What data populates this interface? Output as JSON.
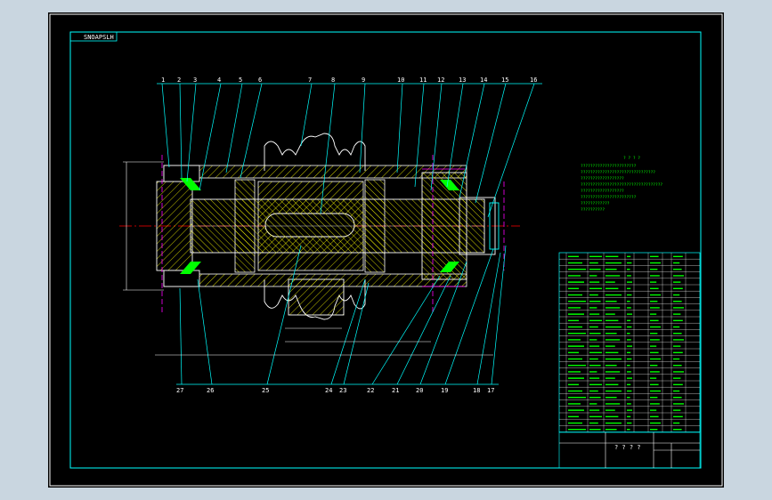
{
  "drawing": {
    "tag": "SNOAPSLH",
    "title_block_text": "? ? ? ?",
    "tech_notes_title": "? ? ? ?",
    "tech_notes": [
      "???????????????????????",
      "???????????????????????????????",
      "??????????????????",
      "??????????????????????????????????",
      "??????????????????",
      "???????????????????????",
      "????????????",
      "??????????"
    ],
    "part_numbers_top": [
      "1",
      "2",
      "3",
      "4",
      "5",
      "6",
      "7",
      "8",
      "9",
      "10",
      "11",
      "12",
      "13",
      "14",
      "15",
      "16"
    ],
    "part_numbers_bottom": [
      "27",
      "26",
      "25",
      "24",
      "23",
      "22",
      "21",
      "20",
      "19",
      "18",
      "17"
    ]
  },
  "colors": {
    "background": "#000000",
    "frame": "#00ffff",
    "centerline": "#ff0000",
    "hatch": "#ffff00",
    "outline": "#ffffff",
    "seals": "#ff00ff",
    "notes": "#00ff00"
  }
}
